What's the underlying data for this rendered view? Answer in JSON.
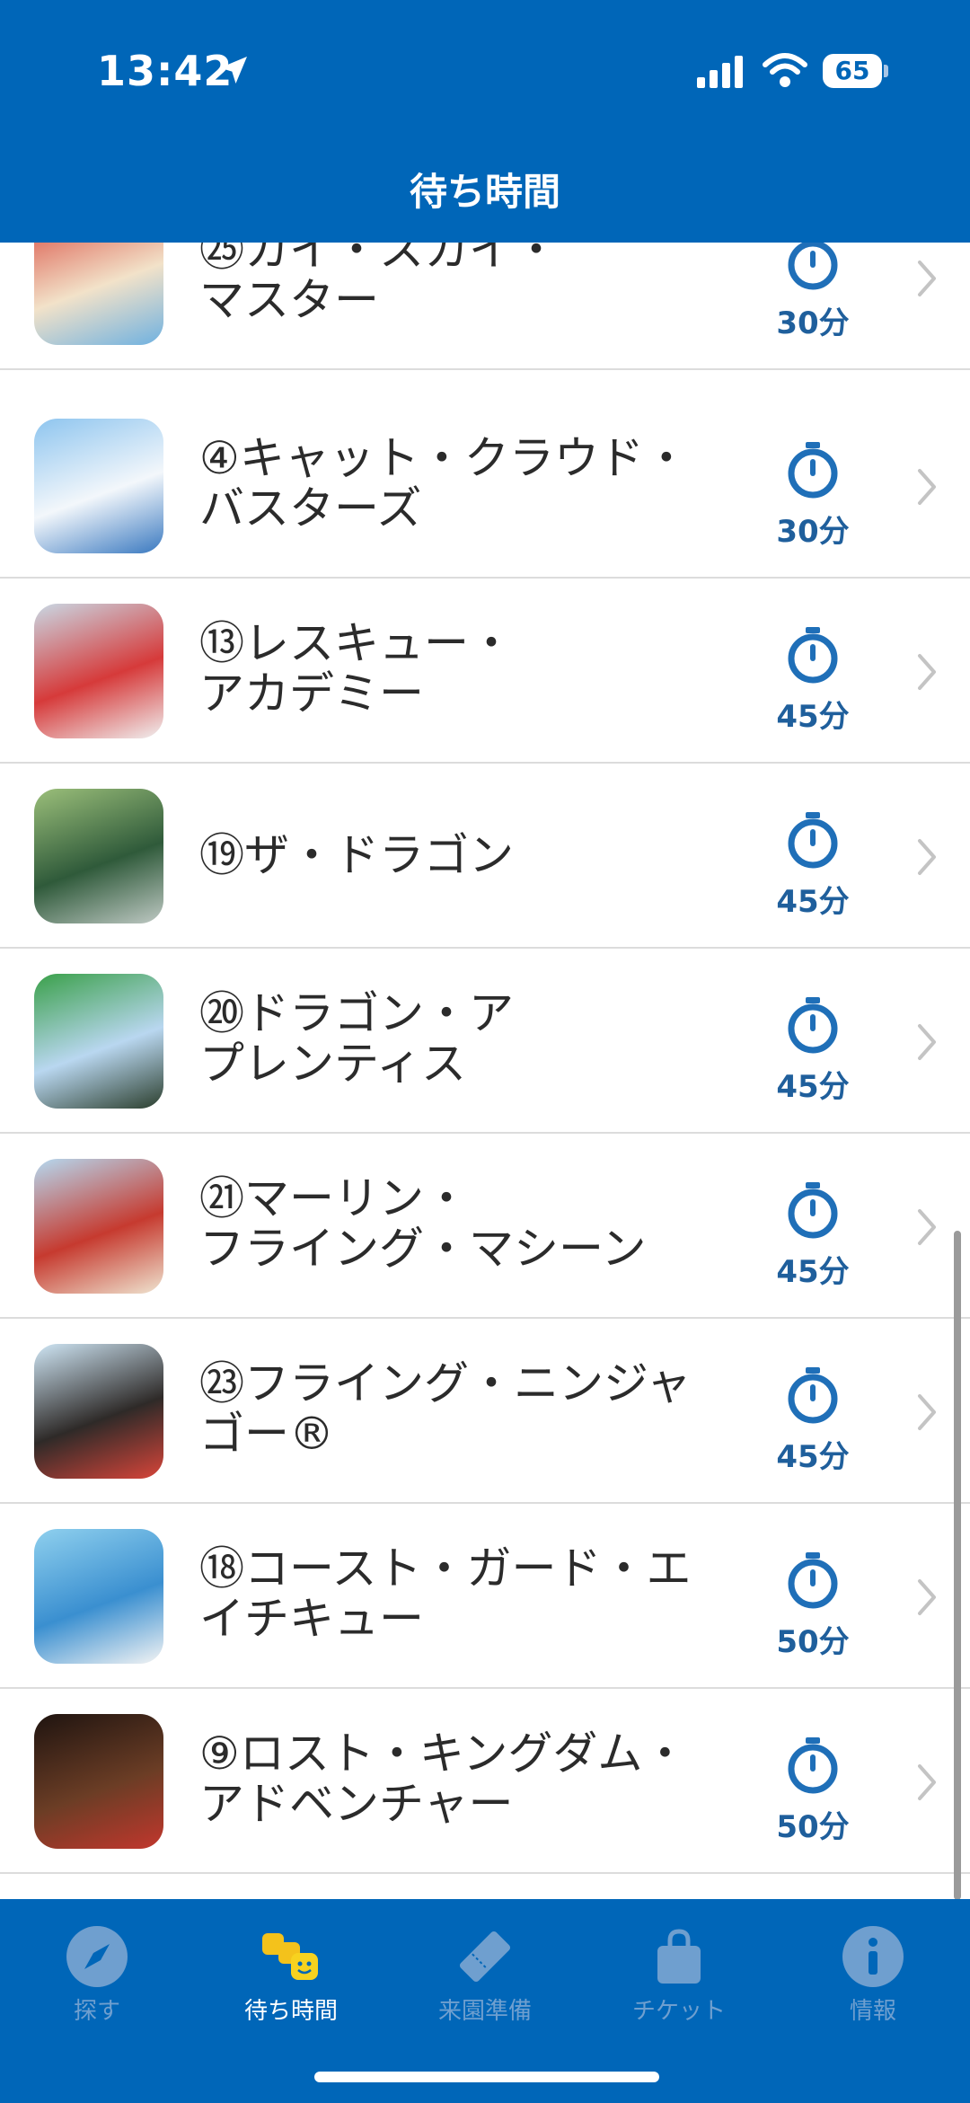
{
  "status": {
    "time": "13:42",
    "battery": "65"
  },
  "header": {
    "title": "待ち時間"
  },
  "rides": [
    {
      "line1": "㉕カイ・スカイ・",
      "line2": "マスター",
      "wait": "30分"
    },
    {
      "line1": "④キャット・クラウド・",
      "line2": "バスターズ",
      "wait": "30分"
    },
    {
      "line1": "⑬レスキュー・",
      "line2": "アカデミー",
      "wait": "45分"
    },
    {
      "line1": "⑲ザ・ドラゴン",
      "line2": "",
      "wait": "45分"
    },
    {
      "line1": "⑳ドラゴン・ア",
      "line2": "プレンティス",
      "wait": "45分"
    },
    {
      "line1": "㉑マーリン・",
      "line2": "フライング・マシーン",
      "wait": "45分"
    },
    {
      "line1": "㉓フライング・ニンジャ",
      "line2": "ゴー®",
      "wait": "45分"
    },
    {
      "line1": "⑱コースト・ガード・エ",
      "line2": "イチキュー",
      "wait": "50分"
    },
    {
      "line1": "⑨ロスト・キングダム・",
      "line2": "アドベンチャー",
      "wait": "50分"
    }
  ],
  "tabs": [
    {
      "label": "探す",
      "icon": "compass-icon"
    },
    {
      "label": "待ち時間",
      "icon": "lego-heads-icon",
      "active": true
    },
    {
      "label": "来園準備",
      "icon": "ticket-stub-icon"
    },
    {
      "label": "チケット",
      "icon": "shopping-bag-icon"
    },
    {
      "label": "情報",
      "icon": "info-icon"
    }
  ],
  "colors": {
    "brand": "#0066b8",
    "wait_text": "#1f5f9c",
    "tab_inactive": "#6f9fcf"
  }
}
